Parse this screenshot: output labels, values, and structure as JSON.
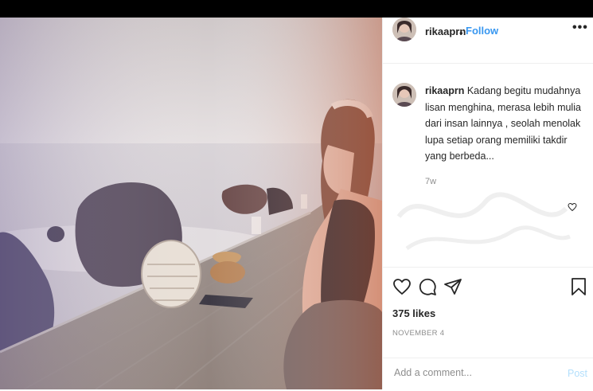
{
  "post": {
    "username": "rikaaprn",
    "separator": "•",
    "follow_label": "Follow",
    "more_label": "•••",
    "caption_user": "rikaaprn",
    "caption_text": "Kadang begitu mudahnya lisan menghina, merasa lebih mulia dari insan lainnya , seolah menolak lupa setiap orang memiliki takdir yang berbeda...",
    "time_ago": "7w",
    "likes": "375 likes",
    "date": "NOVEMBER 4",
    "comment_placeholder": "Add a comment...",
    "post_label": "Post"
  },
  "colors": {
    "accent": "#3897f0",
    "post_disabled": "#b2dffc",
    "text": "#262626",
    "muted": "#8e8e8e"
  },
  "icons": {
    "comment_like": "heart-icon",
    "like": "heart-icon",
    "comment": "comment-icon",
    "share": "share-icon",
    "save": "bookmark-icon"
  }
}
